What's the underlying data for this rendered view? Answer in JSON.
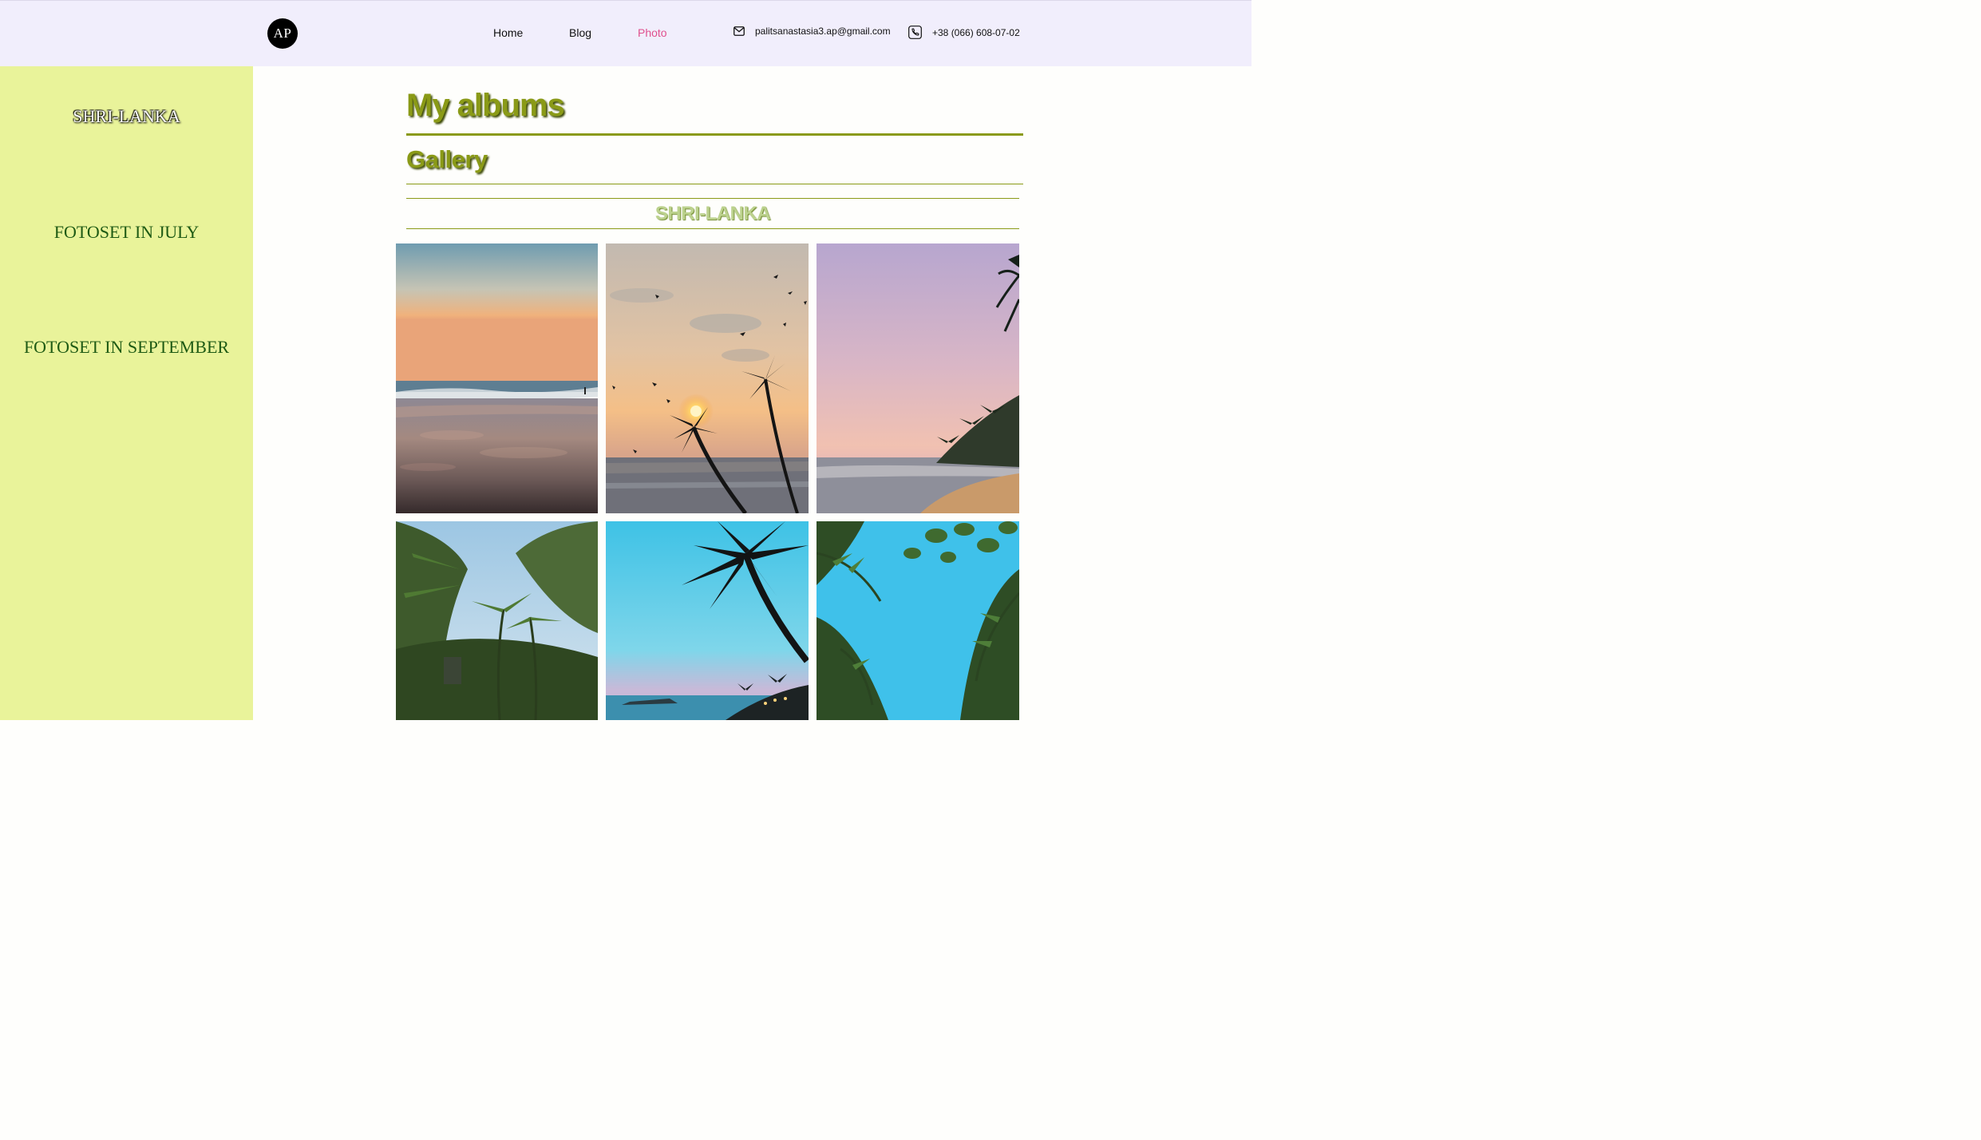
{
  "header": {
    "logo_text": "AP",
    "nav": [
      {
        "label": "Home",
        "active": false
      },
      {
        "label": "Blog",
        "active": false
      },
      {
        "label": "Photo",
        "active": true
      }
    ],
    "email": "palitsanastasia3.ap@gmail.com",
    "phone": "+38 (066) 608-07-02",
    "email_icon": "envelope-icon",
    "phone_icon": "phone-icon"
  },
  "sidebar": {
    "items": [
      {
        "label": "SHRI-LANKA"
      },
      {
        "label": "FOTOSET IN JULY"
      },
      {
        "label": "FOTOSET IN SEPTEMBER"
      }
    ]
  },
  "main": {
    "title": "My albums",
    "subtitle": "Gallery",
    "album_title": "SHRI-LANKA"
  },
  "gallery": {
    "photos": [
      {
        "subject": "beach-sunset"
      },
      {
        "subject": "palm-sunset-birds"
      },
      {
        "subject": "pink-sky-beach"
      },
      {
        "subject": "palm-forest"
      },
      {
        "subject": "palm-silhouette-bay"
      },
      {
        "subject": "palm-leaves-sky"
      }
    ]
  },
  "colors": {
    "header_bg": "#f1eefc",
    "sidebar_bg": "#e9f39a",
    "accent_olive": "#8a9a17",
    "active_nav": "#e0508e",
    "sidebar_text": "#1e5a14"
  }
}
